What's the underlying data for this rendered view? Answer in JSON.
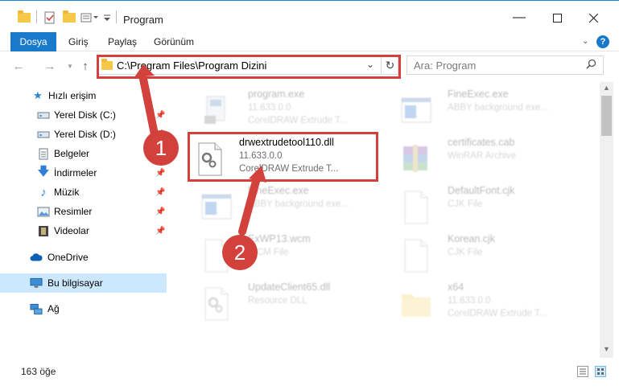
{
  "window": {
    "title": "Program"
  },
  "ribbon": {
    "tabs": [
      "Dosya",
      "Giriş",
      "Paylaş",
      "Görünüm"
    ]
  },
  "address": {
    "path": "C:\\Program Files\\Program Dizini"
  },
  "search": {
    "placeholder": "Ara: Program"
  },
  "sidebar": {
    "items": [
      {
        "label": "Hızlı erişim",
        "icon": "star-icon",
        "pinned": false
      },
      {
        "label": "Yerel Disk (C:)",
        "icon": "drive-icon",
        "pinned": true
      },
      {
        "label": "Yerel Disk (D:)",
        "icon": "drive-icon",
        "pinned": true
      },
      {
        "label": "Belgeler",
        "icon": "documents-icon",
        "pinned": true
      },
      {
        "label": "İndirmeler",
        "icon": "download-icon",
        "pinned": true
      },
      {
        "label": "Müzik",
        "icon": "music-icon",
        "pinned": true
      },
      {
        "label": "Resimler",
        "icon": "pictures-icon",
        "pinned": true
      },
      {
        "label": "Videolar",
        "icon": "video-icon",
        "pinned": true
      },
      {
        "label": "OneDrive",
        "icon": "cloud-icon",
        "pinned": false
      },
      {
        "label": "Bu bilgisayar",
        "icon": "computer-icon",
        "pinned": false
      },
      {
        "label": "Ağ",
        "icon": "network-icon",
        "pinned": false
      }
    ]
  },
  "files": [
    {
      "name": "program.exe",
      "line1": "11.633.0.0",
      "line2": "CorelDRAW Extrude T...",
      "icon": "exe-icon"
    },
    {
      "name": "FineExec.exe",
      "line1": "ABBY background exe...",
      "line2": "",
      "icon": "exe-window-icon"
    },
    {
      "name": "drwextrudetool110.dll",
      "line1": "11.633.0.0",
      "line2": "CorelDRAW Extrude T...",
      "icon": "dll-gear-icon"
    },
    {
      "name": "certificates.cab",
      "line1": "WinRAR Archive",
      "line2": "",
      "icon": "winrar-icon"
    },
    {
      "name": "FineExec.exe",
      "line1": "ABBY background exe...",
      "line2": "",
      "icon": "exe-window-icon"
    },
    {
      "name": "DefaultFont.cjk",
      "line1": "CJK File",
      "line2": "",
      "icon": "blank-file-icon"
    },
    {
      "name": "ExWP13.wcm",
      "line1": "WCM File",
      "line2": "",
      "icon": "blank-file-icon"
    },
    {
      "name": "Korean.cjk",
      "line1": "CJK File",
      "line2": "",
      "icon": "blank-file-icon"
    },
    {
      "name": "UpdateClient65.dll",
      "line1": "Resource DLL",
      "line2": "",
      "icon": "dll-gear-icon"
    },
    {
      "name": "x64",
      "line1": "11.633.0.0",
      "line2": "CorelDRAW Extrude T...",
      "icon": "folder-icon"
    }
  ],
  "status": {
    "count": "163 öğe"
  },
  "annotations": {
    "step1": "1",
    "step2": "2"
  },
  "colors": {
    "accent": "#1979ca",
    "highlight": "#d2413b",
    "selected": "#cce8ff"
  }
}
